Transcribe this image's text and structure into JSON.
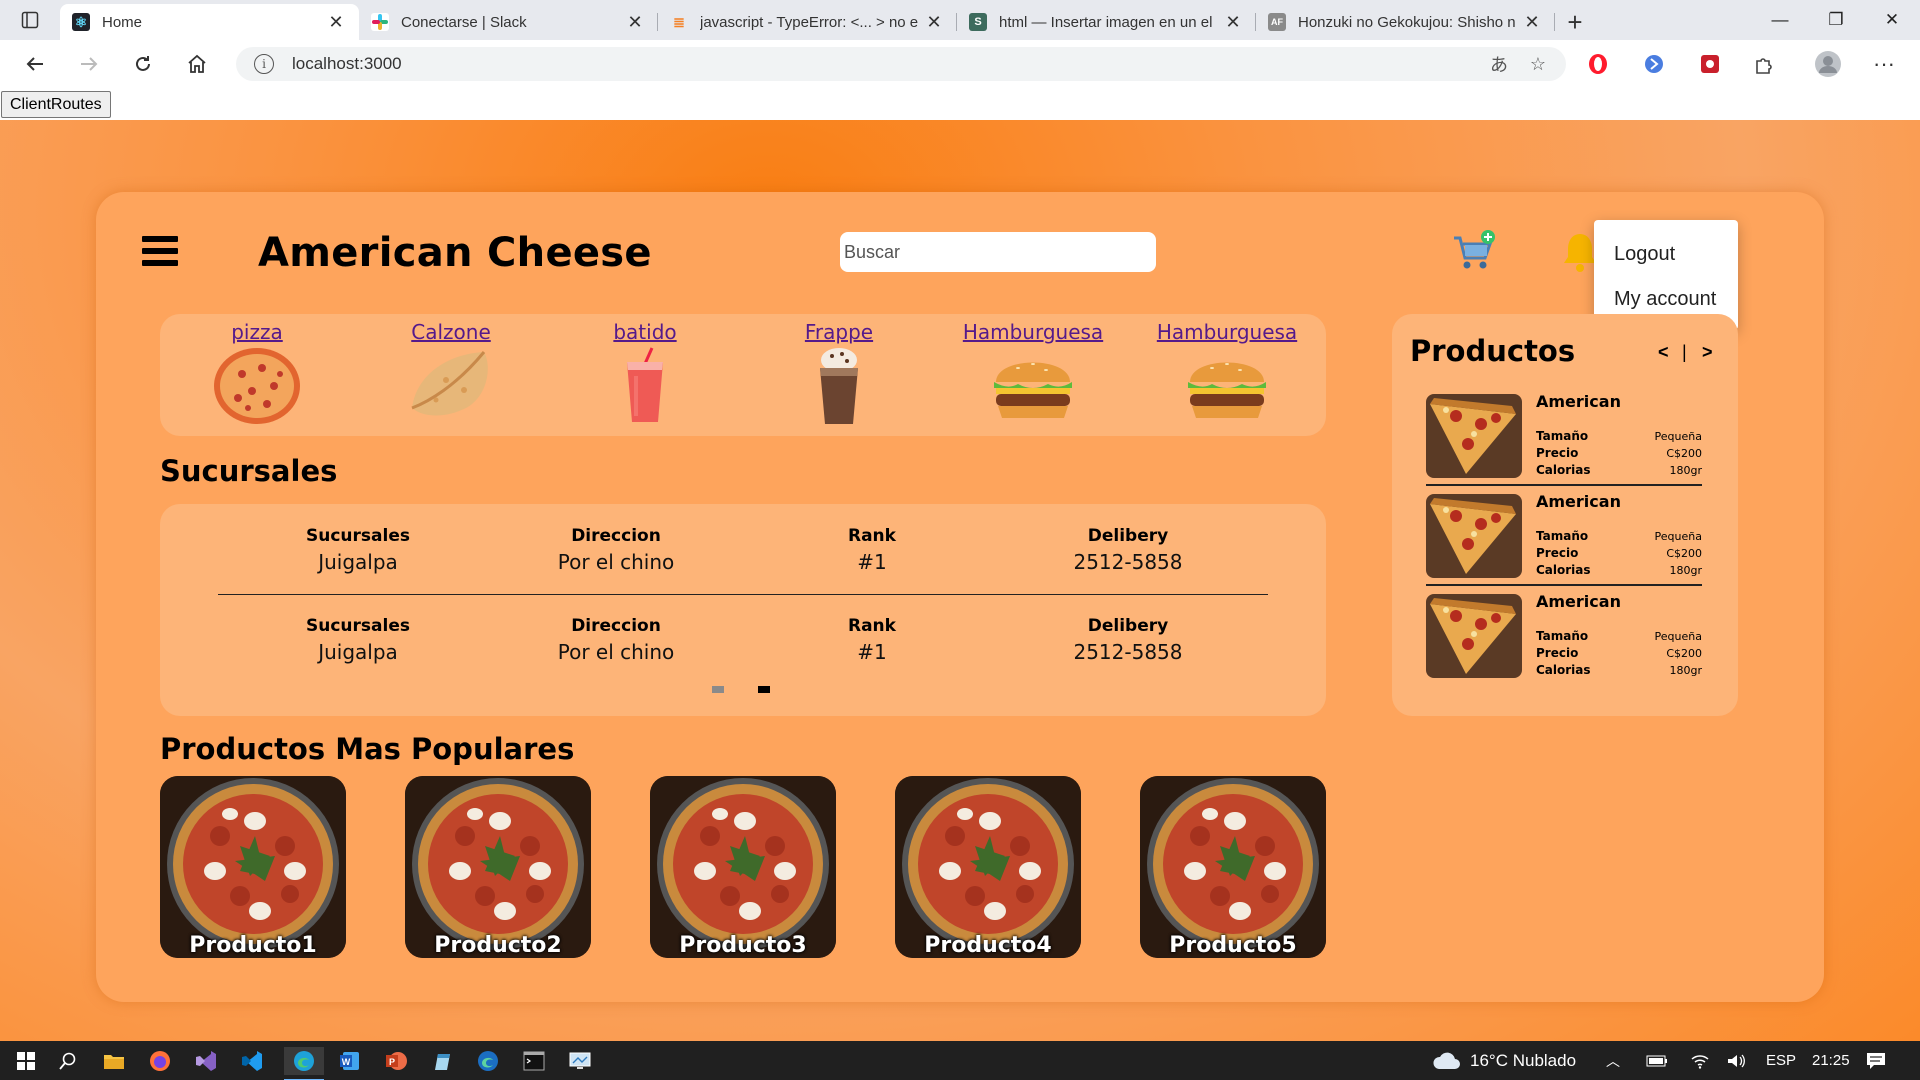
{
  "browser": {
    "tabs": [
      {
        "title": "Home",
        "favicon": "react-icon",
        "active": true
      },
      {
        "title": "Conectarse | Slack",
        "favicon": "slack-icon",
        "active": false
      },
      {
        "title": "javascript - TypeError: <... > no e",
        "favicon": "stackoverflow-icon",
        "active": false
      },
      {
        "title": "html — Insertar imagen en un el",
        "favicon": "stackexchange-icon",
        "active": false
      },
      {
        "title": "Honzuki no Gekokujou: Shisho n",
        "favicon": "anime-site-icon",
        "active": false
      }
    ],
    "url": "localhost:3000",
    "dev_button": "ClientRoutes"
  },
  "app": {
    "brand": "American Cheese",
    "search_placeholder": "Buscar",
    "menu": [
      "Logout",
      "My account"
    ],
    "categories": [
      {
        "label": "pizza",
        "icon": "pizza-icon"
      },
      {
        "label": "Calzone",
        "icon": "calzone-icon"
      },
      {
        "label": "batido",
        "icon": "smoothie-icon"
      },
      {
        "label": "Frappe",
        "icon": "frappe-icon"
      },
      {
        "label": "Hamburguesa",
        "icon": "burger-icon"
      },
      {
        "label": "Hamburguesa",
        "icon": "burger-icon"
      }
    ],
    "sucursales": {
      "title": "Sucursales",
      "headers": [
        "Sucursales",
        "Direccion",
        "Rank",
        "Delibery"
      ],
      "rows": [
        [
          "Juigalpa",
          "Por el chino",
          "#1",
          "2512-5858"
        ],
        [
          "Juigalpa",
          "Por el chino",
          "#1",
          "2512-5858"
        ]
      ],
      "pages": 2,
      "active_page": 2
    },
    "productos": {
      "title": "Productos",
      "prev": "<",
      "sep": "|",
      "next": ">",
      "labels": [
        "Tamaño",
        "Precio",
        "Calorias"
      ],
      "items": [
        {
          "name": "American",
          "size": "Pequeña",
          "price": "C$200",
          "calories": "180gr"
        },
        {
          "name": "American",
          "size": "Pequeña",
          "price": "C$200",
          "calories": "180gr"
        },
        {
          "name": "American",
          "size": "Pequeña",
          "price": "C$200",
          "calories": "180gr"
        }
      ]
    },
    "populares": {
      "title": "Productos Mas Populares",
      "items": [
        "Producto1",
        "Producto2",
        "Producto3",
        "Producto4",
        "Producto5"
      ]
    }
  },
  "taskbar": {
    "weather": "16°C  Nublado",
    "lang": "ESP",
    "time": "21:25"
  },
  "colors": {
    "page_bg": "#fa9340",
    "card_bg": "#fea45c",
    "panel_bg": "#fdb478",
    "link": "#551a8b"
  }
}
